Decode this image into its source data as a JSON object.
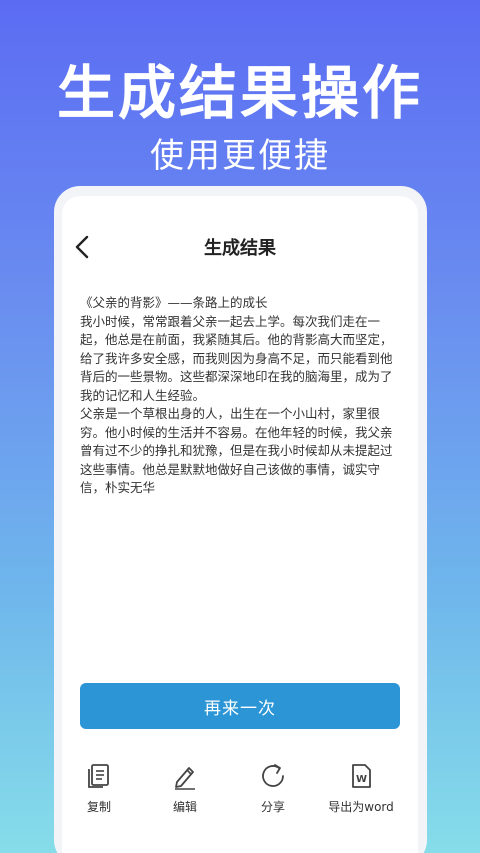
{
  "hero": {
    "title": "生成结果操作",
    "subtitle": "使用更便捷"
  },
  "screen": {
    "title": "生成结果",
    "content": "《父亲的背影》——条路上的成长\n我小时候，常常跟着父亲一起去上学。每次我们走在一起，他总是在前面，我紧随其后。他的背影高大而坚定，给了我许多安全感，而我则因为身高不足，而只能看到他背后的一些景物。这些都深深地印在我的脑海里，成为了我的记忆和人生经验。\n父亲是一个草根出身的人，出生在一个小山村，家里很穷。他小时候的生活并不容易。在他年轻的时候，我父亲曾有过不少的挣扎和犹豫，但是在我小时候却从未提起过这些事情。他总是默默地做好自己该做的事情，诚实守信，朴实无华",
    "retry_label": "再来一次"
  },
  "actions": [
    {
      "label": "复制",
      "icon": "copy-icon"
    },
    {
      "label": "编辑",
      "icon": "edit-icon"
    },
    {
      "label": "分享",
      "icon": "share-icon"
    },
    {
      "label": "导出为word",
      "icon": "word-export-icon"
    }
  ],
  "colors": {
    "accent": "#2b95d6",
    "bg_top": "#5b6cf3",
    "bg_bottom": "#86dde9"
  }
}
